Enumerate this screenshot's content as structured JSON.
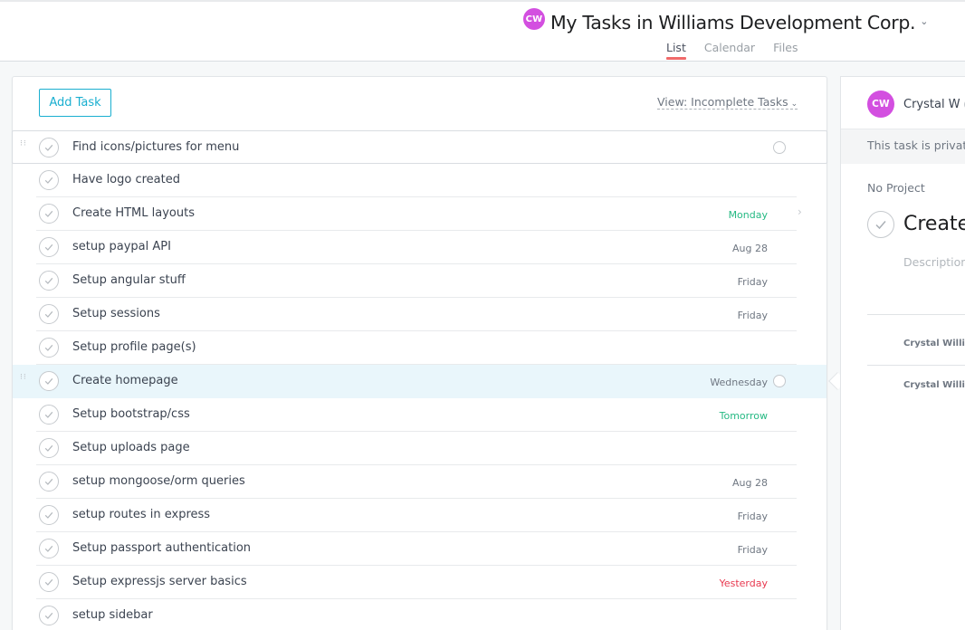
{
  "header": {
    "avatar_initials": "CW",
    "title": "My Tasks in Williams Development Corp.",
    "title_caret": "⌄",
    "tabs": [
      {
        "label": "List",
        "active": true
      },
      {
        "label": "Calendar",
        "active": false
      },
      {
        "label": "Files",
        "active": false
      }
    ]
  },
  "list": {
    "add_task_label": "Add Task",
    "view_filter_label": "View: Incomplete Tasks",
    "view_filter_chevron": "⌄",
    "tasks": [
      {
        "name": "Find icons/pictures for menu",
        "due": "",
        "due_color": "default"
      },
      {
        "name": "Have logo created",
        "due": "",
        "due_color": "default"
      },
      {
        "name": "Create HTML layouts",
        "due": "Monday",
        "due_color": "green"
      },
      {
        "name": "setup paypal API",
        "due": "Aug 28",
        "due_color": "default"
      },
      {
        "name": "Setup angular stuff",
        "due": "Friday",
        "due_color": "default"
      },
      {
        "name": "Setup sessions",
        "due": "Friday",
        "due_color": "default"
      },
      {
        "name": "Setup profile page(s)",
        "due": "",
        "due_color": "default"
      },
      {
        "name": "Create homepage",
        "due": "Wednesday",
        "due_color": "default"
      },
      {
        "name": "Setup bootstrap/css",
        "due": "Tomorrow",
        "due_color": "green"
      },
      {
        "name": "Setup uploads page",
        "due": "",
        "due_color": "default"
      },
      {
        "name": "setup mongoose/orm queries",
        "due": "Aug 28",
        "due_color": "default"
      },
      {
        "name": "setup routes in express",
        "due": "Friday",
        "due_color": "default"
      },
      {
        "name": "Setup passport authentication",
        "due": "Friday",
        "due_color": "default"
      },
      {
        "name": "Setup expressjs server basics",
        "due": "Yesterday",
        "due_color": "red"
      },
      {
        "name": "setup sidebar",
        "due": "",
        "due_color": "default"
      }
    ]
  },
  "detail": {
    "assignee_initials": "CW",
    "assignee_name": "Crystal W",
    "private_notice": "This task is private",
    "project": "No Project",
    "task_title": "Create",
    "description_placeholder": "Description",
    "stories": [
      "Crystal Willia",
      "Crystal Willia"
    ]
  },
  "colors": {
    "accent": "#1aafd0",
    "avatar": "#d34fe0",
    "due_green": "#25b983",
    "due_red": "#e8384f",
    "active_tab_underline": "#f06a6a",
    "selected_row": "#e9f6fb"
  },
  "icons": {
    "check": "check-icon",
    "drag": "drag-handle-icon",
    "chevron": "chevron-right-icon"
  }
}
